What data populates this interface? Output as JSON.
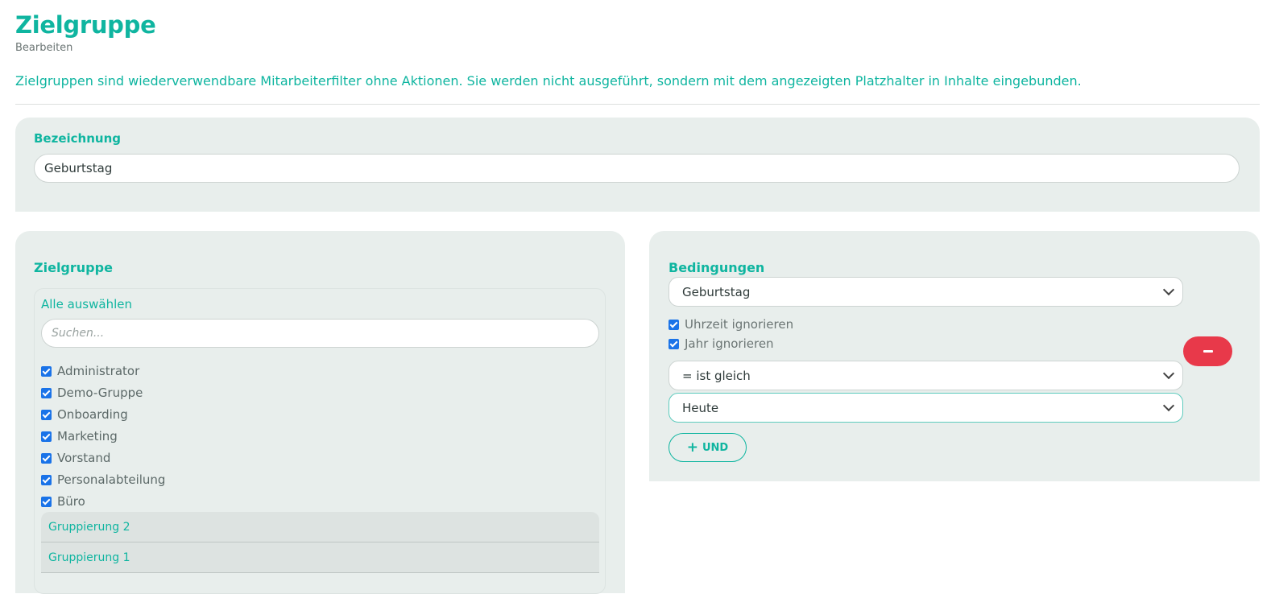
{
  "header": {
    "title": "Zielgruppe",
    "subtitle": "Bearbeiten",
    "intro": "Zielgruppen sind wiederverwendbare Mitarbeiterfilter ohne Aktionen. Sie werden nicht ausgeführt, sondern mit dem angezeigten Platzhalter in Inhalte eingebunden."
  },
  "name_section": {
    "label": "Bezeichnung",
    "value": "Geburtstag"
  },
  "group_section": {
    "label": "Zielgruppe",
    "select_all": "Alle auswählen",
    "search_placeholder": "Suchen...",
    "groups": [
      "Administrator",
      "Demo-Gruppe",
      "Onboarding",
      "Marketing",
      "Vorstand",
      "Personalabteilung",
      "Büro"
    ],
    "groupings": [
      "Gruppierung 2",
      "Gruppierung 1"
    ]
  },
  "conditions": {
    "label": "Bedingungen",
    "field": "Geburtstag",
    "ignore_time": "Uhrzeit ignorieren",
    "ignore_year": "Jahr ignorieren",
    "operator": "= ist gleich",
    "value": "Heute",
    "add_and": "UND"
  },
  "colors": {
    "accent": "#0fb5a0",
    "panel": "#e8eeec",
    "danger": "#e8394a"
  }
}
